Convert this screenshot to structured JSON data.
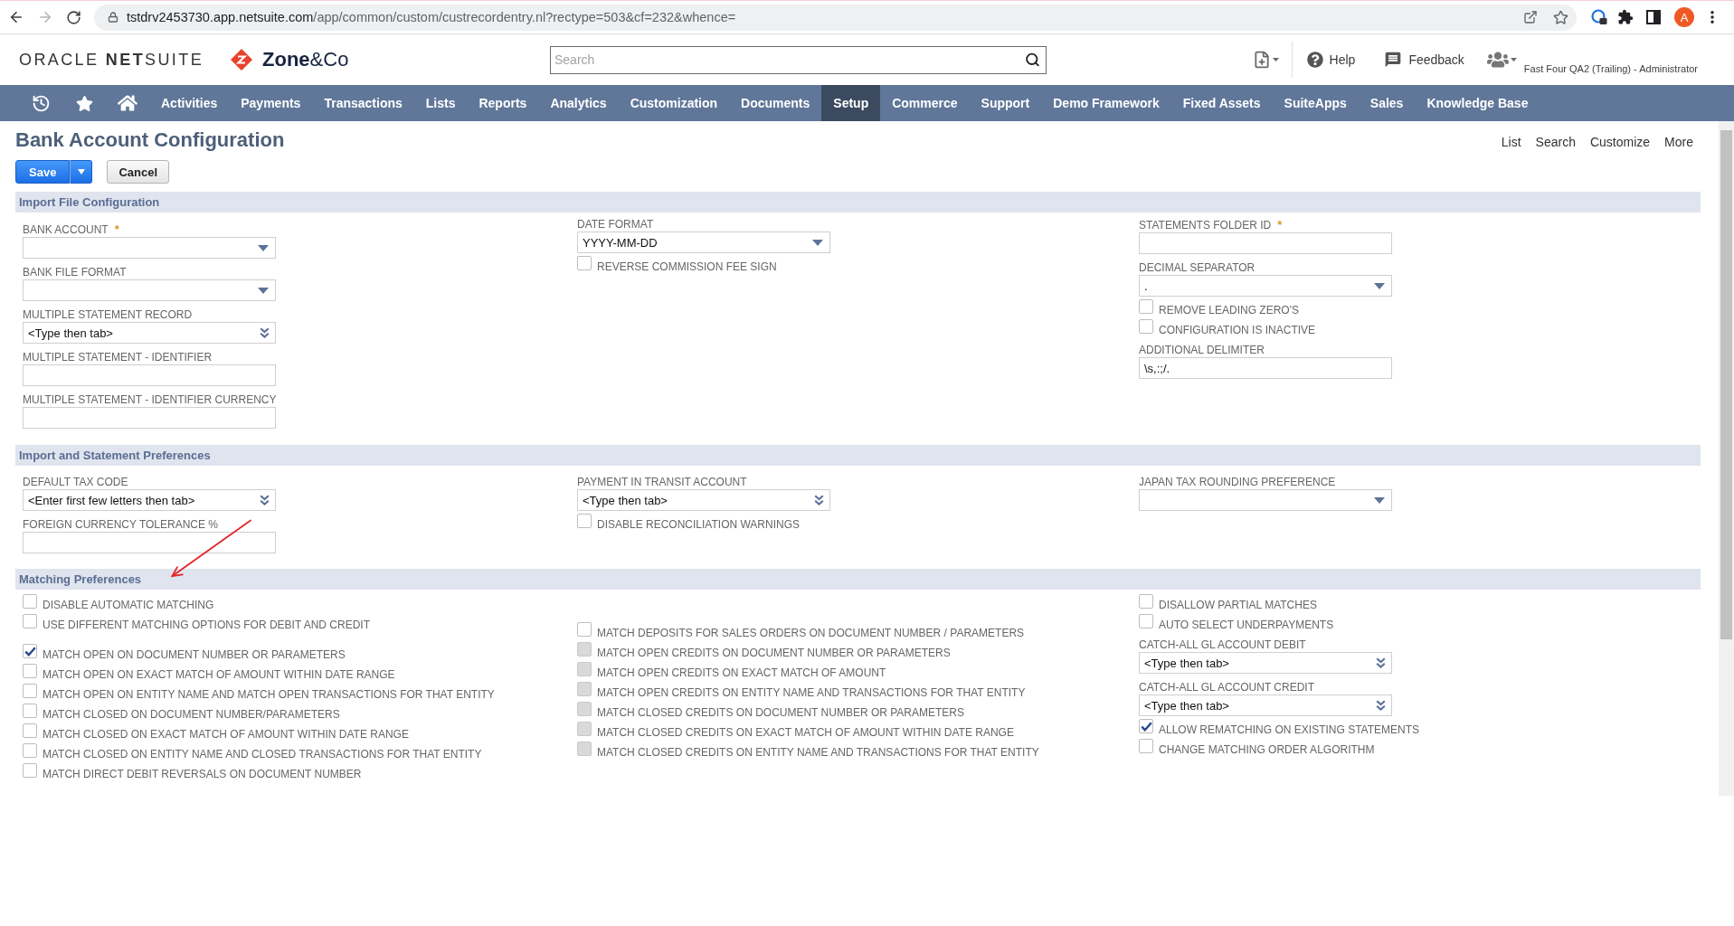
{
  "browser": {
    "forward_disabled": true,
    "url_host": "tstdrv2453730.app.netsuite.com",
    "url_path": "/app/common/custom/custrecordentry.nl?rectype=503&cf=232&whence=",
    "profile_letter": "A"
  },
  "header": {
    "logo": "ORACLE **NET**SUITE",
    "partner_logo": "**Zone**&Co",
    "search": {
      "placeholder": "Search"
    },
    "help": "Help",
    "feedback": "Feedback",
    "account": "Fast Four QA2 (Trailing) - Administrator"
  },
  "nav": [
    {
      "label": "Activities",
      "selected": false
    },
    {
      "label": "Payments",
      "selected": false
    },
    {
      "label": "Transactions",
      "selected": false
    },
    {
      "label": "Lists",
      "selected": false
    },
    {
      "label": "Reports",
      "selected": false
    },
    {
      "label": "Analytics",
      "selected": false
    },
    {
      "label": "Customization",
      "selected": false
    },
    {
      "label": "Documents",
      "selected": false
    },
    {
      "label": "Setup",
      "selected": true
    },
    {
      "label": "Commerce",
      "selected": false
    },
    {
      "label": "Support",
      "selected": false
    },
    {
      "label": "Demo Framework",
      "selected": false
    },
    {
      "label": "Fixed Assets",
      "selected": false
    },
    {
      "label": "SuiteApps",
      "selected": false
    },
    {
      "label": "Sales",
      "selected": false
    },
    {
      "label": "Knowledge Base",
      "selected": false
    }
  ],
  "page": {
    "title": "Bank Account Configuration",
    "links": [
      "List",
      "Search",
      "Customize",
      "More"
    ],
    "save": "Save",
    "cancel": "Cancel"
  },
  "import_file_configuration": {
    "title": "Import File Configuration",
    "columns": [
      {
        "fields": [
          {
            "kind": "select",
            "label": "BANK ACCOUNT",
            "required_mark": "*"
          },
          {
            "kind": "select",
            "label": "BANK FILE FORMAT"
          },
          {
            "kind": "lookup",
            "label": "MULTIPLE STATEMENT RECORD",
            "placeholder": "<Type then tab>"
          },
          {
            "kind": "text",
            "label": "MULTIPLE STATEMENT - IDENTIFIER"
          },
          {
            "kind": "text",
            "label": "MULTIPLE STATEMENT - IDENTIFIER CURRENCY"
          }
        ]
      },
      {
        "fields": [
          {
            "kind": "select",
            "label": "DATE FORMAT",
            "value": "YYYY-MM-DD"
          },
          {
            "kind": "checkbox",
            "label": "REVERSE COMMISSION FEE SIGN",
            "checked": false,
            "disabled": false
          }
        ]
      },
      {
        "fields": [
          {
            "kind": "text",
            "label": "STATEMENTS FOLDER ID",
            "required_mark": "*"
          },
          {
            "kind": "select",
            "label": "DECIMAL SEPARATOR",
            "value": "."
          },
          {
            "kind": "checkbox",
            "label": "REMOVE LEADING ZERO'S",
            "checked": false,
            "disabled": false
          },
          {
            "kind": "checkbox",
            "label": "CONFIGURATION IS INACTIVE",
            "checked": false,
            "disabled": false
          },
          {
            "kind": "text",
            "label": "ADDITIONAL DELIMITER",
            "value": "\\s,:;/."
          }
        ]
      }
    ]
  },
  "import_and_statement_preferences": {
    "title": "Import and Statement Preferences",
    "columns": [
      {
        "fields": [
          {
            "kind": "lookup",
            "label": "DEFAULT TAX CODE",
            "placeholder": "<Enter first few letters then tab>"
          },
          {
            "kind": "text",
            "label": "FOREIGN CURRENCY TOLERANCE %"
          }
        ]
      },
      {
        "fields": [
          {
            "kind": "lookup",
            "label": "PAYMENT IN TRANSIT ACCOUNT",
            "placeholder": "<Type then tab>"
          },
          {
            "kind": "checkbox",
            "label": "DISABLE RECONCILIATION WARNINGS",
            "checked": false,
            "disabled": false
          }
        ]
      },
      {
        "fields": [
          {
            "kind": "select",
            "label": "JAPAN TAX ROUNDING PREFERENCE"
          }
        ]
      }
    ]
  },
  "matching_preferences": {
    "title": "Matching Preferences",
    "columns": [
      {
        "fields": [
          {
            "kind": "checkbox",
            "label": "DISABLE AUTOMATIC MATCHING",
            "checked": false,
            "disabled": false
          },
          {
            "kind": "checkbox",
            "label": "USE DIFFERENT MATCHING OPTIONS FOR DEBIT AND CREDIT",
            "checked": false,
            "disabled": false
          },
          {
            "kind": "checkbox",
            "label": "MATCH OPEN ON DOCUMENT NUMBER OR PARAMETERS",
            "checked": true,
            "disabled": false
          },
          {
            "kind": "checkbox",
            "label": "MATCH OPEN ON EXACT MATCH OF AMOUNT WITHIN DATE RANGE",
            "checked": false,
            "disabled": false
          },
          {
            "kind": "checkbox",
            "label": "MATCH OPEN ON ENTITY NAME AND MATCH OPEN TRANSACTIONS FOR THAT ENTITY",
            "checked": false,
            "disabled": false
          },
          {
            "kind": "checkbox",
            "label": "MATCH CLOSED ON DOCUMENT NUMBER/PARAMETERS",
            "checked": false,
            "disabled": false
          },
          {
            "kind": "checkbox",
            "label": "MATCH CLOSED ON EXACT MATCH OF AMOUNT WITHIN DATE RANGE",
            "checked": false,
            "disabled": false
          },
          {
            "kind": "checkbox",
            "label": "MATCH CLOSED ON ENTITY NAME AND CLOSED TRANSACTIONS FOR THAT ENTITY",
            "checked": false,
            "disabled": false
          },
          {
            "kind": "checkbox",
            "label": "MATCH DIRECT DEBIT REVERSALS ON DOCUMENT NUMBER",
            "checked": false,
            "disabled": false
          }
        ]
      },
      {
        "fields": [
          {
            "kind": "checkbox",
            "label": "MATCH DEPOSITS FOR SALES ORDERS ON DOCUMENT NUMBER / PARAMETERS",
            "checked": false,
            "disabled": false
          },
          {
            "kind": "checkbox",
            "label": "MATCH OPEN CREDITS ON DOCUMENT NUMBER OR PARAMETERS",
            "checked": false,
            "disabled": true
          },
          {
            "kind": "checkbox",
            "label": "MATCH OPEN CREDITS ON EXACT MATCH OF AMOUNT",
            "checked": false,
            "disabled": true
          },
          {
            "kind": "checkbox",
            "label": "MATCH OPEN CREDITS ON ENTITY NAME AND TRANSACTIONS FOR THAT ENTITY",
            "checked": false,
            "disabled": true
          },
          {
            "kind": "checkbox",
            "label": "MATCH CLOSED CREDITS ON DOCUMENT NUMBER OR PARAMETERS",
            "checked": false,
            "disabled": true
          },
          {
            "kind": "checkbox",
            "label": "MATCH CLOSED CREDITS ON EXACT MATCH OF AMOUNT WITHIN DATE RANGE",
            "checked": false,
            "disabled": true
          },
          {
            "kind": "checkbox",
            "label": "MATCH CLOSED CREDITS ON ENTITY NAME AND TRANSACTIONS FOR THAT ENTITY",
            "checked": false,
            "disabled": true
          }
        ]
      },
      {
        "fields": [
          {
            "kind": "checkbox",
            "label": "DISALLOW PARTIAL MATCHES",
            "checked": false,
            "disabled": false
          },
          {
            "kind": "checkbox",
            "label": "AUTO SELECT UNDERPAYMENTS",
            "checked": false,
            "disabled": false
          },
          {
            "kind": "lookup",
            "label": "CATCH-ALL GL ACCOUNT DEBIT",
            "placeholder": "<Type then tab>"
          },
          {
            "kind": "lookup",
            "label": "CATCH-ALL GL ACCOUNT CREDIT",
            "placeholder": "<Type then tab>"
          },
          {
            "kind": "checkbox",
            "label": "ALLOW REMATCHING ON EXISTING STATEMENTS",
            "checked": true,
            "disabled": false
          },
          {
            "kind": "checkbox",
            "label": "CHANGE MATCHING ORDER ALGORITHM",
            "checked": false,
            "disabled": false
          }
        ]
      }
    ]
  }
}
